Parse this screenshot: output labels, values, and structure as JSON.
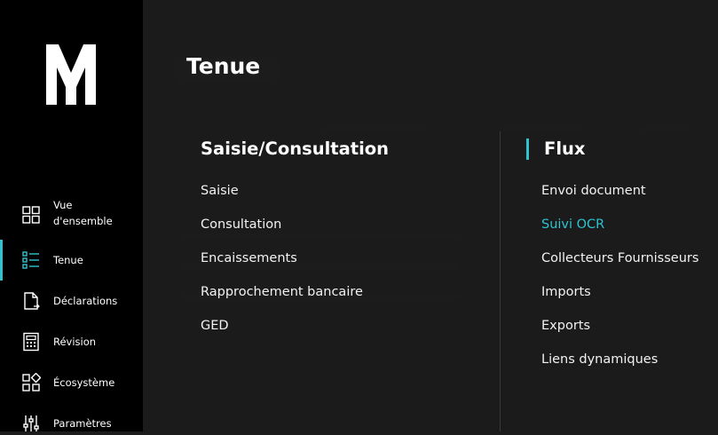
{
  "sidebar": {
    "items": [
      {
        "label": "Vue\nd'ensemble",
        "icon": "grid-icon"
      },
      {
        "label": "Tenue",
        "icon": "list-icon",
        "active": true
      },
      {
        "label": "Déclarations",
        "icon": "document-icon"
      },
      {
        "label": "Révision",
        "icon": "calculator-icon"
      },
      {
        "label": "Écosystème",
        "icon": "ecosystem-icon"
      },
      {
        "label": "Paramètres",
        "icon": "sliders-icon"
      }
    ]
  },
  "menu": {
    "title": "Tenue",
    "left_section": {
      "heading": "Saisie/Consultation",
      "links": [
        "Saisie",
        "Consultation",
        "Encaissements",
        "Rapprochement bancaire",
        "GED"
      ]
    },
    "right_section": {
      "heading": "Flux",
      "links": [
        "Envoi document",
        "Suivi OCR",
        "Collecteurs Fournisseurs",
        "Imports",
        "Exports",
        "Liens dynamiques"
      ],
      "active_link": "Suivi OCR"
    }
  },
  "colors": {
    "accent": "#2ec4cf",
    "sidebar_bg": "#000000",
    "menu_bg": "#1c1c1c"
  }
}
